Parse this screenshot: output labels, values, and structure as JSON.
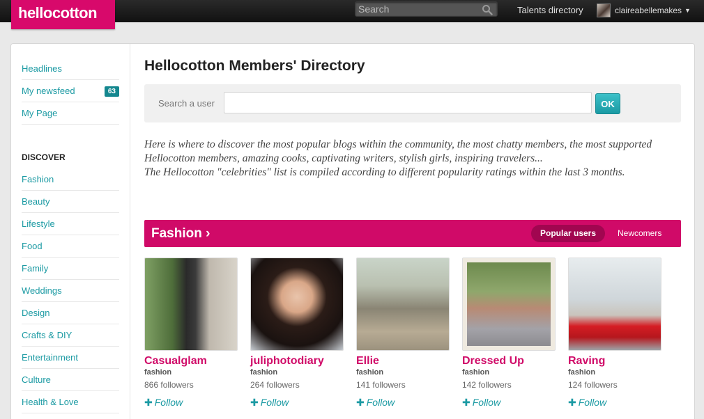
{
  "header": {
    "logo": "hellocotton",
    "search_placeholder": "Search",
    "talents_link": "Talents directory",
    "username": "claireabellemakes"
  },
  "sidebar": {
    "top_items": [
      {
        "label": "Headlines"
      },
      {
        "label": "My newsfeed",
        "badge": "63"
      },
      {
        "label": "My Page"
      }
    ],
    "discover_heading": "DISCOVER",
    "discover_items": [
      "Fashion",
      "Beauty",
      "Lifestyle",
      "Food",
      "Family",
      "Weddings",
      "Design",
      "Crafts & DIY",
      "Entertainment",
      "Culture",
      "Health & Love"
    ]
  },
  "main": {
    "title": "Hellocotton Members' Directory",
    "search_label": "Search a user",
    "search_value": "",
    "ok_label": "OK",
    "intro_line1": "Here is where to discover the most popular blogs within the community, the most chatty members, the most supported Hellocotton members, amazing cooks, captivating writers, stylish girls, inspiring travelers...",
    "intro_line2": "The Hellocotton \"celebrities\" list is compiled according to different popularity ratings within the last 3 months.",
    "section_title": "Fashion ›",
    "tab_popular": "Popular users",
    "tab_new": "Newcomers",
    "follow_label": "Follow",
    "users": [
      {
        "name": "Casualglam",
        "category": "fashion",
        "followers": "866 followers"
      },
      {
        "name": "juliphotodiary",
        "category": "fashion",
        "followers": "264 followers"
      },
      {
        "name": "Ellie",
        "category": "fashion",
        "followers": "141 followers"
      },
      {
        "name": "Dressed Up",
        "category": "fashion",
        "followers": "142 followers"
      },
      {
        "name": "Raving",
        "category": "fashion",
        "followers": "124 followers"
      }
    ]
  },
  "colors": {
    "brand": "#d8096b",
    "accent": "#1b9aa3"
  }
}
